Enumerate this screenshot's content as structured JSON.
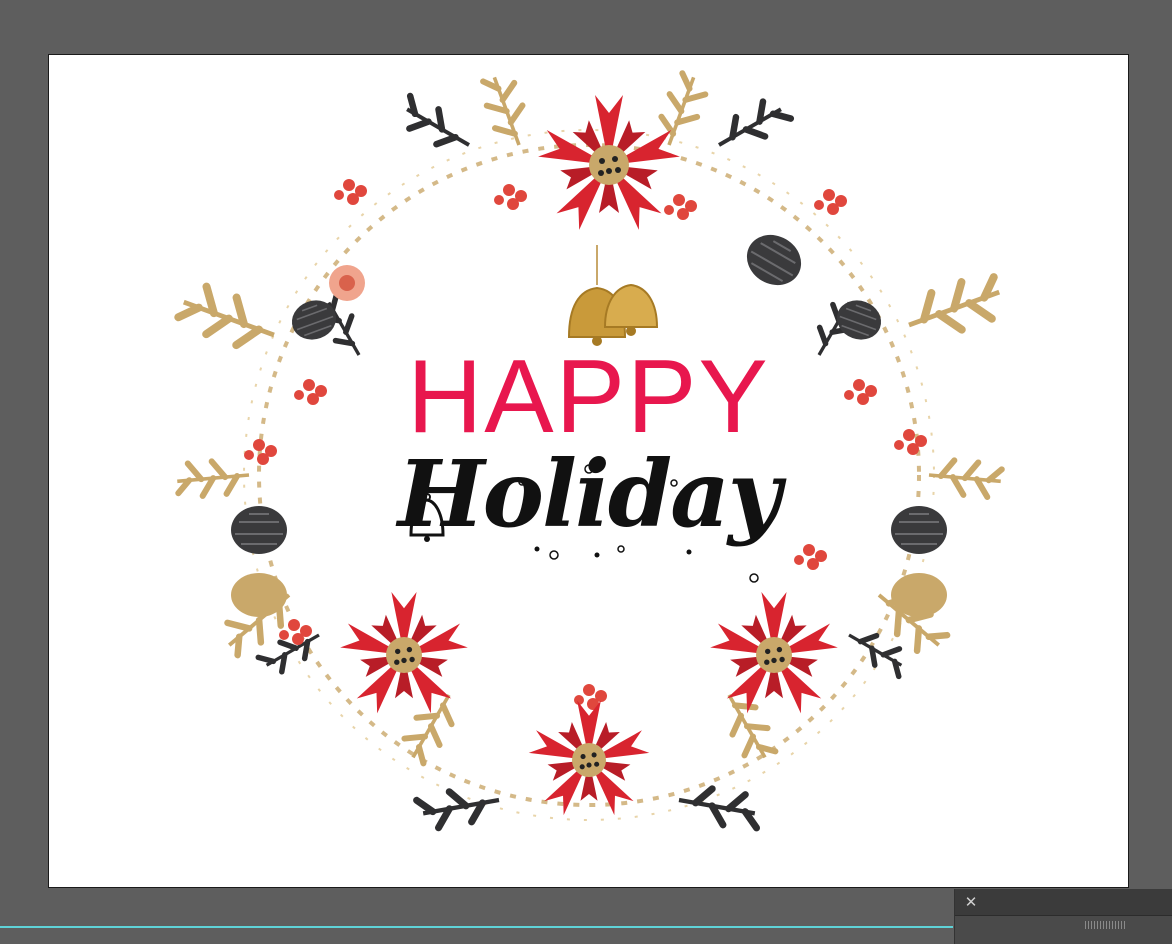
{
  "card": {
    "line1": "HAPPY",
    "line2": "Holiday"
  },
  "panel": {
    "close_glyph": "✕"
  },
  "colors": {
    "canvas_bg": "#5e5e5e",
    "artboard": "#ffffff",
    "happy_text": "#e8174e",
    "poinsettia": "#d8242f",
    "gold_leaf": "#c9a86a",
    "berry": "#e0473d",
    "dark_leaf": "#3a3a3c",
    "scroll_accent": "#5fd3d8"
  },
  "icons": [
    "bells-icon",
    "bell-outline-icon",
    "poinsettia-icon",
    "pinecone-icon",
    "berry-cluster-icon",
    "close-icon"
  ]
}
